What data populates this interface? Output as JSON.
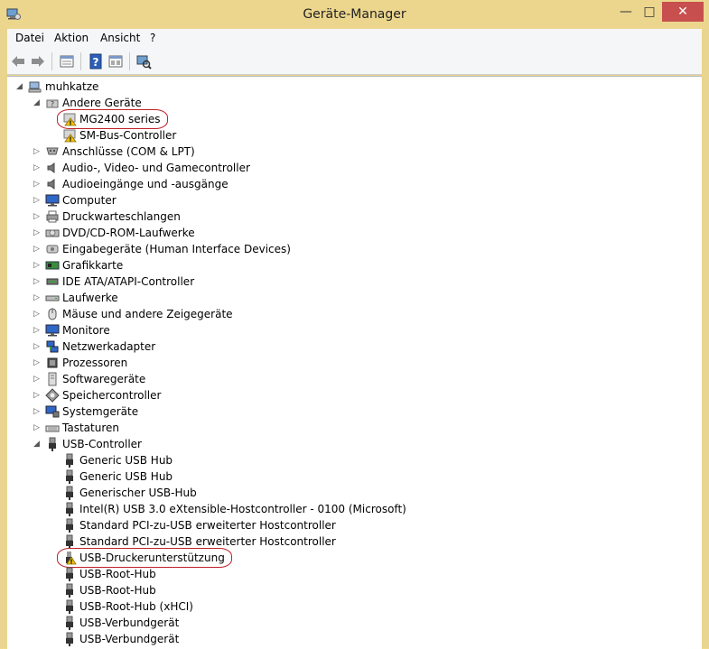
{
  "window": {
    "title": "Geräte-Manager",
    "minimize": "—",
    "maximize": "□",
    "close": "✕"
  },
  "menu": [
    "Datei",
    "Aktion",
    "Ansicht",
    "?"
  ],
  "toolbar": [
    {
      "name": "back-arrow-icon"
    },
    {
      "name": "forward-arrow-icon"
    },
    {
      "name": "properties-grid-icon"
    },
    {
      "name": "help-book-icon"
    },
    {
      "name": "update-driver-icon"
    },
    {
      "name": "scan-hardware-icon"
    }
  ],
  "colors": {
    "accent_close": "#c7504f",
    "title_bar": "#ecd68e",
    "highlight_ellipse": "#c0212a",
    "warning": "#f2c40f"
  },
  "tree": [
    {
      "level": 0,
      "expander": "open",
      "icon": "computer-icon",
      "label": "muhkatze"
    },
    {
      "level": 1,
      "expander": "open",
      "icon": "other-devices-icon",
      "label": "Andere Geräte"
    },
    {
      "level": 2,
      "expander": "none",
      "icon": "warning-device-icon",
      "label": "MG2400 series",
      "highlight": true
    },
    {
      "level": 2,
      "expander": "none",
      "icon": "warning-device-icon",
      "label": "SM-Bus-Controller"
    },
    {
      "level": 1,
      "expander": "closed",
      "icon": "port-icon",
      "label": "Anschlüsse (COM & LPT)"
    },
    {
      "level": 1,
      "expander": "closed",
      "icon": "speaker-icon",
      "label": "Audio-, Video- und Gamecontroller"
    },
    {
      "level": 1,
      "expander": "closed",
      "icon": "speaker-icon",
      "label": "Audioeingänge und -ausgänge"
    },
    {
      "level": 1,
      "expander": "closed",
      "icon": "monitor-icon",
      "label": "Computer"
    },
    {
      "level": 1,
      "expander": "closed",
      "icon": "printer-icon",
      "label": "Druckwarteschlangen"
    },
    {
      "level": 1,
      "expander": "closed",
      "icon": "disc-drive-icon",
      "label": "DVD/CD-ROM-Laufwerke"
    },
    {
      "level": 1,
      "expander": "closed",
      "icon": "hid-icon",
      "label": "Eingabegeräte (Human Interface Devices)"
    },
    {
      "level": 1,
      "expander": "closed",
      "icon": "display-adapter-icon",
      "label": "Grafikkarte"
    },
    {
      "level": 1,
      "expander": "closed",
      "icon": "ide-controller-icon",
      "label": "IDE ATA/ATAPI-Controller"
    },
    {
      "level": 1,
      "expander": "closed",
      "icon": "drive-icon",
      "label": "Laufwerke"
    },
    {
      "level": 1,
      "expander": "closed",
      "icon": "mouse-icon",
      "label": "Mäuse und andere Zeigegeräte"
    },
    {
      "level": 1,
      "expander": "closed",
      "icon": "monitor-icon",
      "label": "Monitore"
    },
    {
      "level": 1,
      "expander": "closed",
      "icon": "network-adapter-icon",
      "label": "Netzwerkadapter"
    },
    {
      "level": 1,
      "expander": "closed",
      "icon": "processor-icon",
      "label": "Prozessoren"
    },
    {
      "level": 1,
      "expander": "closed",
      "icon": "software-device-icon",
      "label": "Softwaregeräte"
    },
    {
      "level": 1,
      "expander": "closed",
      "icon": "storage-controller-icon",
      "label": "Speichercontroller"
    },
    {
      "level": 1,
      "expander": "closed",
      "icon": "system-device-icon",
      "label": "Systemgeräte"
    },
    {
      "level": 1,
      "expander": "closed",
      "icon": "keyboard-icon",
      "label": "Tastaturen"
    },
    {
      "level": 1,
      "expander": "open",
      "icon": "usb-plug-icon",
      "label": "USB-Controller"
    },
    {
      "level": 2,
      "expander": "none",
      "icon": "usb-plug-icon",
      "label": "Generic USB Hub"
    },
    {
      "level": 2,
      "expander": "none",
      "icon": "usb-plug-icon",
      "label": "Generic USB Hub"
    },
    {
      "level": 2,
      "expander": "none",
      "icon": "usb-plug-icon",
      "label": "Generischer USB-Hub"
    },
    {
      "level": 2,
      "expander": "none",
      "icon": "usb-plug-icon",
      "label": "Intel(R) USB 3.0 eXtensible-Hostcontroller - 0100 (Microsoft)"
    },
    {
      "level": 2,
      "expander": "none",
      "icon": "usb-plug-icon",
      "label": "Standard PCI-zu-USB erweiterter Hostcontroller"
    },
    {
      "level": 2,
      "expander": "none",
      "icon": "usb-plug-icon",
      "label": "Standard PCI-zu-USB erweiterter Hostcontroller"
    },
    {
      "level": 2,
      "expander": "none",
      "icon": "usb-warning-icon",
      "label": "USB-Druckerunterstützung",
      "highlight": true
    },
    {
      "level": 2,
      "expander": "none",
      "icon": "usb-plug-icon",
      "label": "USB-Root-Hub"
    },
    {
      "level": 2,
      "expander": "none",
      "icon": "usb-plug-icon",
      "label": "USB-Root-Hub"
    },
    {
      "level": 2,
      "expander": "none",
      "icon": "usb-plug-icon",
      "label": "USB-Root-Hub (xHCI)"
    },
    {
      "level": 2,
      "expander": "none",
      "icon": "usb-plug-icon",
      "label": "USB-Verbundgerät"
    },
    {
      "level": 2,
      "expander": "none",
      "icon": "usb-plug-icon",
      "label": "USB-Verbundgerät"
    }
  ]
}
